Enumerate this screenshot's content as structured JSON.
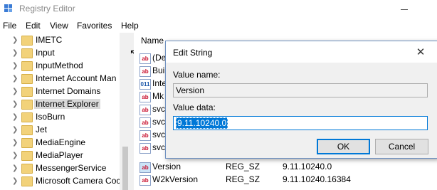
{
  "window": {
    "title": "Registry Editor"
  },
  "menu": [
    "File",
    "Edit",
    "View",
    "Favorites",
    "Help"
  ],
  "tree": {
    "items": [
      {
        "label": "IMETC",
        "expandable": true
      },
      {
        "label": "Input",
        "expandable": true
      },
      {
        "label": "InputMethod",
        "expandable": true
      },
      {
        "label": "Internet Account Man",
        "expandable": true
      },
      {
        "label": "Internet Domains",
        "expandable": true
      },
      {
        "label": "Internet Explorer",
        "expandable": true,
        "selected": true
      },
      {
        "label": "IsoBurn",
        "expandable": true
      },
      {
        "label": "Jet",
        "expandable": true
      },
      {
        "label": "MediaEngine",
        "expandable": true
      },
      {
        "label": "MediaPlayer",
        "expandable": true
      },
      {
        "label": "MessengerService",
        "expandable": true
      },
      {
        "label": "Microsoft Camera Coc",
        "expandable": true
      }
    ]
  },
  "list": {
    "column_name": "Name",
    "rows": [
      {
        "name": "(De",
        "type": "",
        "data": "",
        "icon": "string-value-icon"
      },
      {
        "name": "Buil",
        "type": "",
        "data": "",
        "icon": "string-value-icon"
      },
      {
        "name": "Inte",
        "type": "",
        "data": "",
        "icon": "binary-value-icon"
      },
      {
        "name": "Mk",
        "type": "",
        "data": "",
        "icon": "string-value-icon"
      },
      {
        "name": "svc",
        "type": "",
        "data": "",
        "icon": "string-value-icon"
      },
      {
        "name": "svc",
        "type": "",
        "data": "",
        "icon": "string-value-icon"
      },
      {
        "name": "svc",
        "type": "",
        "data": "",
        "icon": "string-value-icon"
      },
      {
        "name": "svc",
        "type": "",
        "data": "",
        "icon": "string-value-icon"
      },
      {
        "name": "Version",
        "type": "REG_SZ",
        "data": "9.11.10240.0",
        "icon": "string-value-icon",
        "selected": true
      },
      {
        "name": "W2kVersion",
        "type": "REG_SZ",
        "data": "9.11.10240.16384",
        "icon": "string-value-icon"
      }
    ]
  },
  "dialog": {
    "title": "Edit String",
    "value_name_label": "Value name:",
    "value_name": "Version",
    "value_data_label": "Value data:",
    "value_data": "9.11.10240.0",
    "ok_label": "OK",
    "cancel_label": "Cancel"
  },
  "icons": {
    "close": "close-icon",
    "folder": "folder-icon",
    "chevron": "chevron-right-icon"
  },
  "colors": {
    "accent": "#0078d7",
    "folder": "#f2d27a",
    "selection": "#d9d9d9"
  }
}
